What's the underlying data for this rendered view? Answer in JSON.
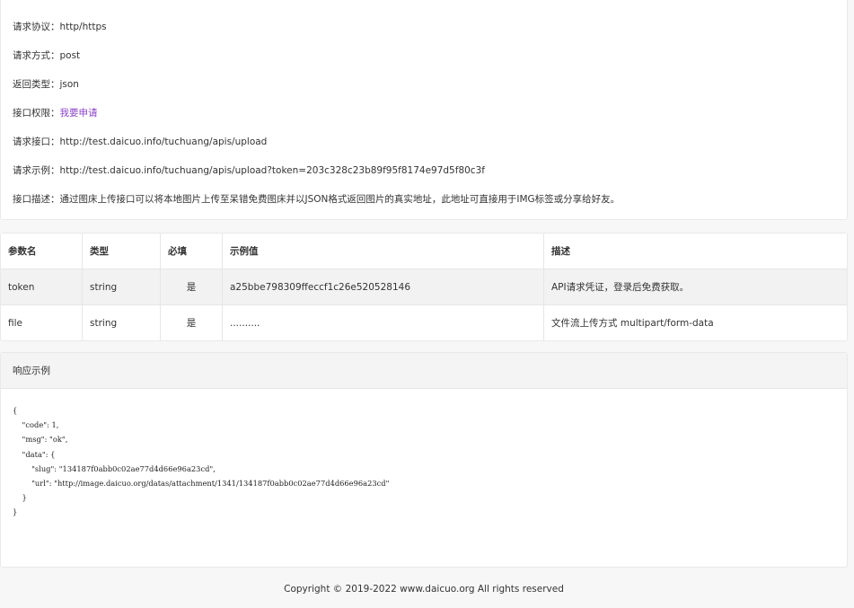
{
  "info": {
    "rows": [
      {
        "label": "请求协议",
        "value": "http/https"
      },
      {
        "label": "请求方式",
        "value": "post"
      },
      {
        "label": "返回类型",
        "value": "json"
      },
      {
        "label": "接口权限",
        "value": "我要申请"
      },
      {
        "label": "请求接口",
        "value": "http://test.daicuo.info/tuchuang/apis/upload"
      },
      {
        "label": "请求示例",
        "value": "http://test.daicuo.info/tuchuang/apis/upload?token=203c328c23b89f95f8174e97d5f80c3f"
      },
      {
        "label": "接口描述",
        "value": "通过图床上传接口可以将本地图片上传至呆错免费图床并以JSON格式返回图片的真实地址，此地址可直接用于IMG标签或分享给好友。"
      }
    ],
    "separator": "：",
    "link_color": "#8a43c9"
  },
  "params": {
    "headers": [
      "参数名",
      "类型",
      "必填",
      "示例值",
      "描述"
    ],
    "rows": [
      {
        "name": "token",
        "type": "string",
        "required": "是",
        "example": "a25bbe798309ffeccf1c26e520528146",
        "desc": "API请求凭证，登录后免费获取。"
      },
      {
        "name": "file",
        "type": "string",
        "required": "是",
        "example": "..........",
        "desc": "文件流上传方式 multipart/form-data"
      }
    ]
  },
  "response": {
    "title": "响应示例",
    "code": "{\n    \"code\": 1,\n    \"msg\": \"ok\",\n    \"data\": {\n        \"slug\": \"134187f0abb0c02ae77d4d66e96a23cd\",\n        \"url\": \"http://image.daicuo.org/datas/attachment/1341/134187f0abb0c02ae77d4d66e96a23cd\"\n    }\n}"
  },
  "footer": {
    "copyright": "Copyright © 2019-2022 www.daicuo.org All rights reserved"
  }
}
